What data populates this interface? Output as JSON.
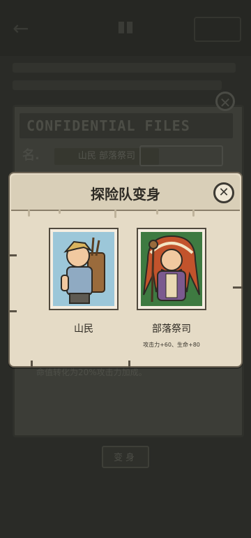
{
  "background": {
    "back_icon": "arrow-left-icon",
    "files_banner": "CONFIDENTIAL  FILES",
    "name_prefix": "名.",
    "name_value": "山民 部落祭司",
    "description": "命值转化为20%攻击力加成。",
    "action_button": "变身"
  },
  "dialog": {
    "title": "探险队变身",
    "close_icon": "close-icon",
    "options": [
      {
        "name": "山民",
        "stats": ""
      },
      {
        "name": "部落祭司",
        "stats": "攻击力+60、生命+80"
      }
    ]
  },
  "colors": {
    "dialog_bg": "#e5dbc6",
    "card_left_bg": "#9cc7d9",
    "card_right_bg": "#3e7a41",
    "overlay": "#1e1f1c"
  }
}
